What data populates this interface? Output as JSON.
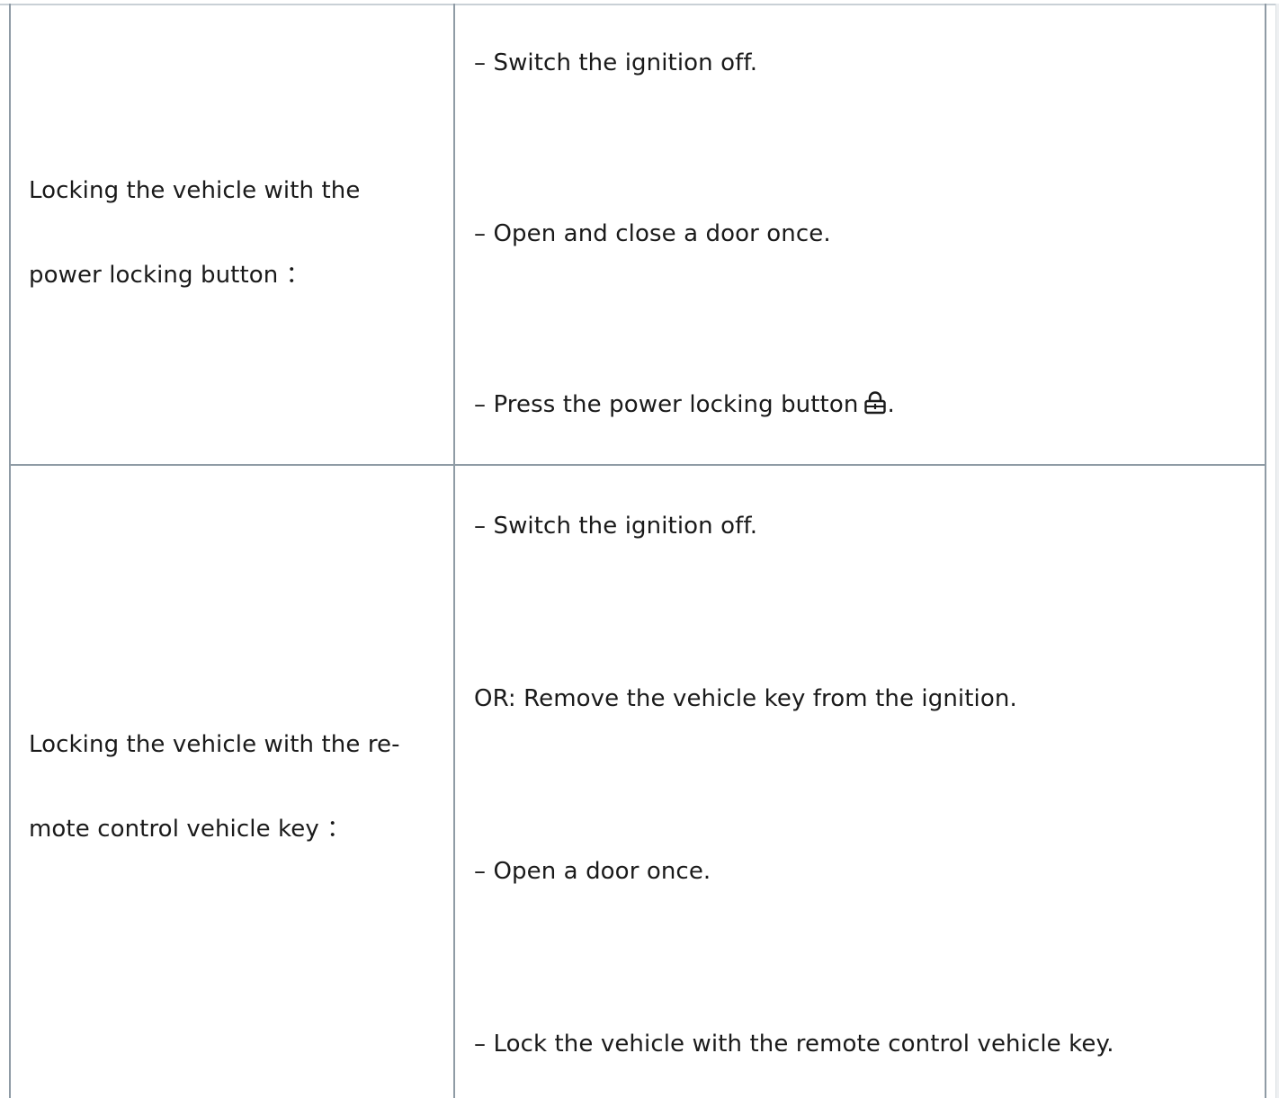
{
  "table": {
    "rows": [
      {
        "label_line1": "Locking the vehicle with the",
        "label_line2": "power locking button ：",
        "steps": [
          "– Switch the ignition off.",
          "– Open and close a door once.",
          "– Press the power locking button"
        ],
        "step_suffix": ".",
        "inline_icon": "lock-icon"
      },
      {
        "label_line1": "Locking the vehicle with the re-",
        "label_line2": "mote control vehicle key ：",
        "steps": [
          "– Switch the ignition off.",
          "OR: Remove the vehicle key from the ignition.",
          "– Open a door once.",
          "– Lock the vehicle with the remote control vehicle key."
        ]
      }
    ]
  }
}
